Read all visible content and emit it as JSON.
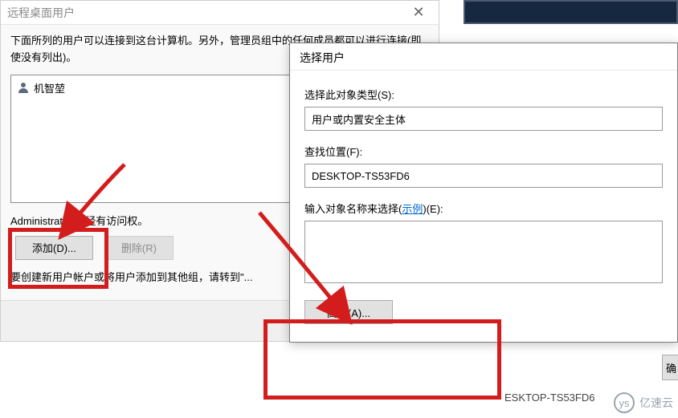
{
  "back_dialog": {
    "title": "远程桌面用户",
    "close_glyph": "✕",
    "description": "下面所列的用户可以连接到这台计算机。另外，管理员组中的任何成员都可以进行连接(即使没有列出)。",
    "user_list": [
      {
        "name": "机智堃"
      }
    ],
    "admin_note": "Administrator 已经有访问权。",
    "add_button": "添加(D)...",
    "remove_button": "删除(R)",
    "create_note": "要创建新用户帐户或将用户添加到其他组，请转到\"...",
    "ok_button": "确"
  },
  "front_dialog": {
    "title": "选择用户",
    "object_type_label": "选择此对象类型(S):",
    "object_type_value": "用户或内置安全主体",
    "location_label": "查找位置(F):",
    "location_value": "DESKTOP-TS53FD6",
    "names_label_prefix": "输入对象名称来选择(",
    "names_label_link": "示例",
    "names_label_suffix": ")(E):",
    "names_value": "",
    "advanced_button": "高级(A)...",
    "right_cut_button": "确"
  },
  "footer": {
    "cut_host_text": "ESKTOP-TS53FD6",
    "watermark_text": "亿速云",
    "watermark_icon": "ys"
  },
  "colors": {
    "annotation": "#d31c1c"
  }
}
